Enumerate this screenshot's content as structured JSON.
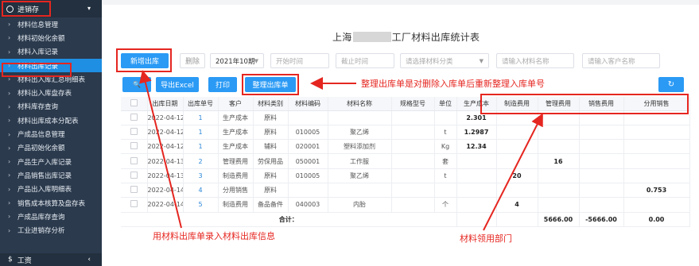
{
  "sidebar": {
    "header": "进销存",
    "items": [
      "材料信息管理",
      "材料初始化余额",
      "材料入库记录",
      "材料出库记录",
      "材料出入库汇总明细表",
      "材料出入库盘存表",
      "材料库存查询",
      "材料出库成本分配表",
      "产成品信息管理",
      "产品初始化余额",
      "产品生产入库记录",
      "产品销售出库记录",
      "产品出入库明细表",
      "销售成本核算及盘存表",
      "产成品库存查询",
      "工业进销存分析"
    ],
    "active_index": 3,
    "bottom": "工资"
  },
  "page": {
    "title_prefix": "上海",
    "title_suffix": "工厂材料出库统计表"
  },
  "toolbar": {
    "add_label": "新增出库",
    "delete_label": "删除",
    "month_value": "2021年10期",
    "start_placeholder": "开始时间",
    "end_placeholder": "截止时间",
    "category_placeholder": "请选择材料分类",
    "name_placeholder": "请输入材料名称",
    "customer_placeholder": "请输入客户名称",
    "search_icon": "🔍",
    "export_label": "导出Excel",
    "print_label": "打印",
    "reorg_label": "整理出库单",
    "refresh_icon": "↻"
  },
  "annotations": {
    "reorg": "整理出库单是对删除入库单后重新整理入库单号",
    "entry": "用材料出库单录入材料出库信息",
    "dept": "材料领用部门"
  },
  "table": {
    "headers": [
      "",
      "出库日期",
      "出库单号",
      "客户",
      "材料类别",
      "材料编码",
      "材料名称",
      "规格型号",
      "单位",
      "生产成本",
      "制造费用",
      "管理费用",
      "销售费用",
      "分用销售"
    ],
    "rows": [
      [
        "2022-04-12",
        "1",
        "生产成本",
        "原料",
        "",
        "",
        "",
        "",
        "2.301",
        "",
        "",
        "",
        ""
      ],
      [
        "2022-04-12",
        "1",
        "生产成本",
        "原料",
        "010005",
        "聚乙烯",
        "",
        "t",
        "1.2987",
        "",
        "",
        "",
        ""
      ],
      [
        "2022-04-12",
        "1",
        "生产成本",
        "辅料",
        "020001",
        "塑料添加剂",
        "",
        "Kg",
        "12.34",
        "",
        "",
        "",
        ""
      ],
      [
        "2022-04-13",
        "2",
        "管理费用",
        "劳保用品",
        "050001",
        "工作服",
        "",
        "套",
        "",
        "",
        "16",
        "",
        ""
      ],
      [
        "2022-04-13",
        "3",
        "制造费用",
        "原料",
        "010005",
        "聚乙烯",
        "",
        "t",
        "",
        "20",
        "",
        "",
        ""
      ],
      [
        "2022-04-14",
        "4",
        "分用销售",
        "原料",
        "",
        "",
        "",
        "",
        "",
        "",
        "",
        "",
        "0.753"
      ],
      [
        "2022-04-14",
        "5",
        "制造费用",
        "备品备件",
        "040003",
        "内胎",
        "",
        "个",
        "",
        "4",
        "",
        "",
        ""
      ]
    ],
    "total_label": "合计：",
    "totals": [
      "",
      "",
      "5666.00",
      "-5666.00",
      "0.00"
    ]
  }
}
